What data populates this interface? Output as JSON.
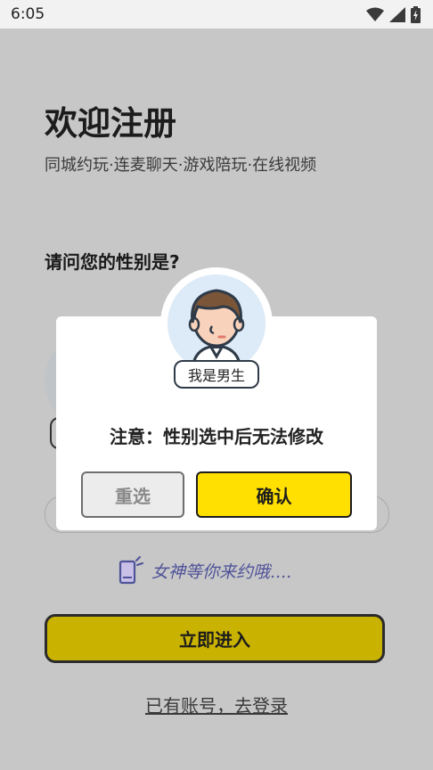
{
  "status_bar": {
    "time": "6:05",
    "icons": [
      "wifi-icon",
      "signal-icon",
      "battery-icon"
    ]
  },
  "page": {
    "title": "欢迎注册",
    "subtitle": "同城约玩·连麦聊天·游戏陪玩·在线视频",
    "question": "请问您的性别是?",
    "hint_text": "女神等你来约哦....",
    "enter_button": "立即进入",
    "login_link": "已有账号，去登录"
  },
  "dialog": {
    "gender_tag": "我是男生",
    "notice": "注意：性别选中后无法修改",
    "reset_button": "重选",
    "confirm_button": "确认"
  },
  "colors": {
    "accent_yellow": "#ffe000",
    "dimmed_yellow": "#c9b200",
    "overlay_gray": "#c7c7c7",
    "hint_purple": "#4f5399"
  }
}
